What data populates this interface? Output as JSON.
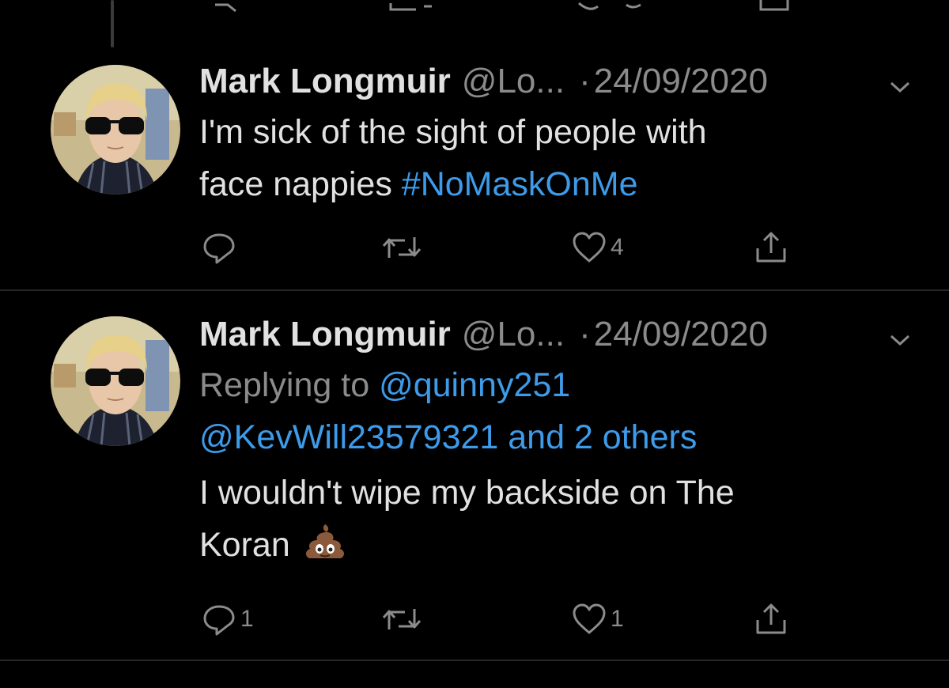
{
  "colors": {
    "background": "#000000",
    "text": "#e1e1e1",
    "muted": "#8b8b8b",
    "link": "#3d9be9",
    "divider": "#262626"
  },
  "top_partial": {
    "icons": [
      "reply-icon",
      "retweet-icon",
      "like-icon",
      "share-icon"
    ]
  },
  "tweets": [
    {
      "name": "Mark Longmuir",
      "handle": "@Lo...",
      "separator": "·",
      "date": "24/09/2020",
      "text_line1": "I'm sick of the sight of people with",
      "text_line2": "face nappies ",
      "hashtag": "#NoMaskOnMe",
      "actions": {
        "reply_count": "",
        "retweet_count": "",
        "like_count": "4",
        "share_icon": "share-icon"
      }
    },
    {
      "name": "Mark Longmuir",
      "handle": "@Lo...",
      "separator": "·",
      "date": "24/09/2020",
      "replying_prefix": "Replying to ",
      "replying_mention1": "@quinny251",
      "replying_line2": "@KevWill23579321 and 2 others",
      "text_line1": "I wouldn't wipe my backside on The",
      "text_line2": "Koran",
      "emoji": "pile-of-poo-icon",
      "actions": {
        "reply_count": "1",
        "retweet_count": "",
        "like_count": "1",
        "share_icon": "share-icon"
      }
    }
  ]
}
